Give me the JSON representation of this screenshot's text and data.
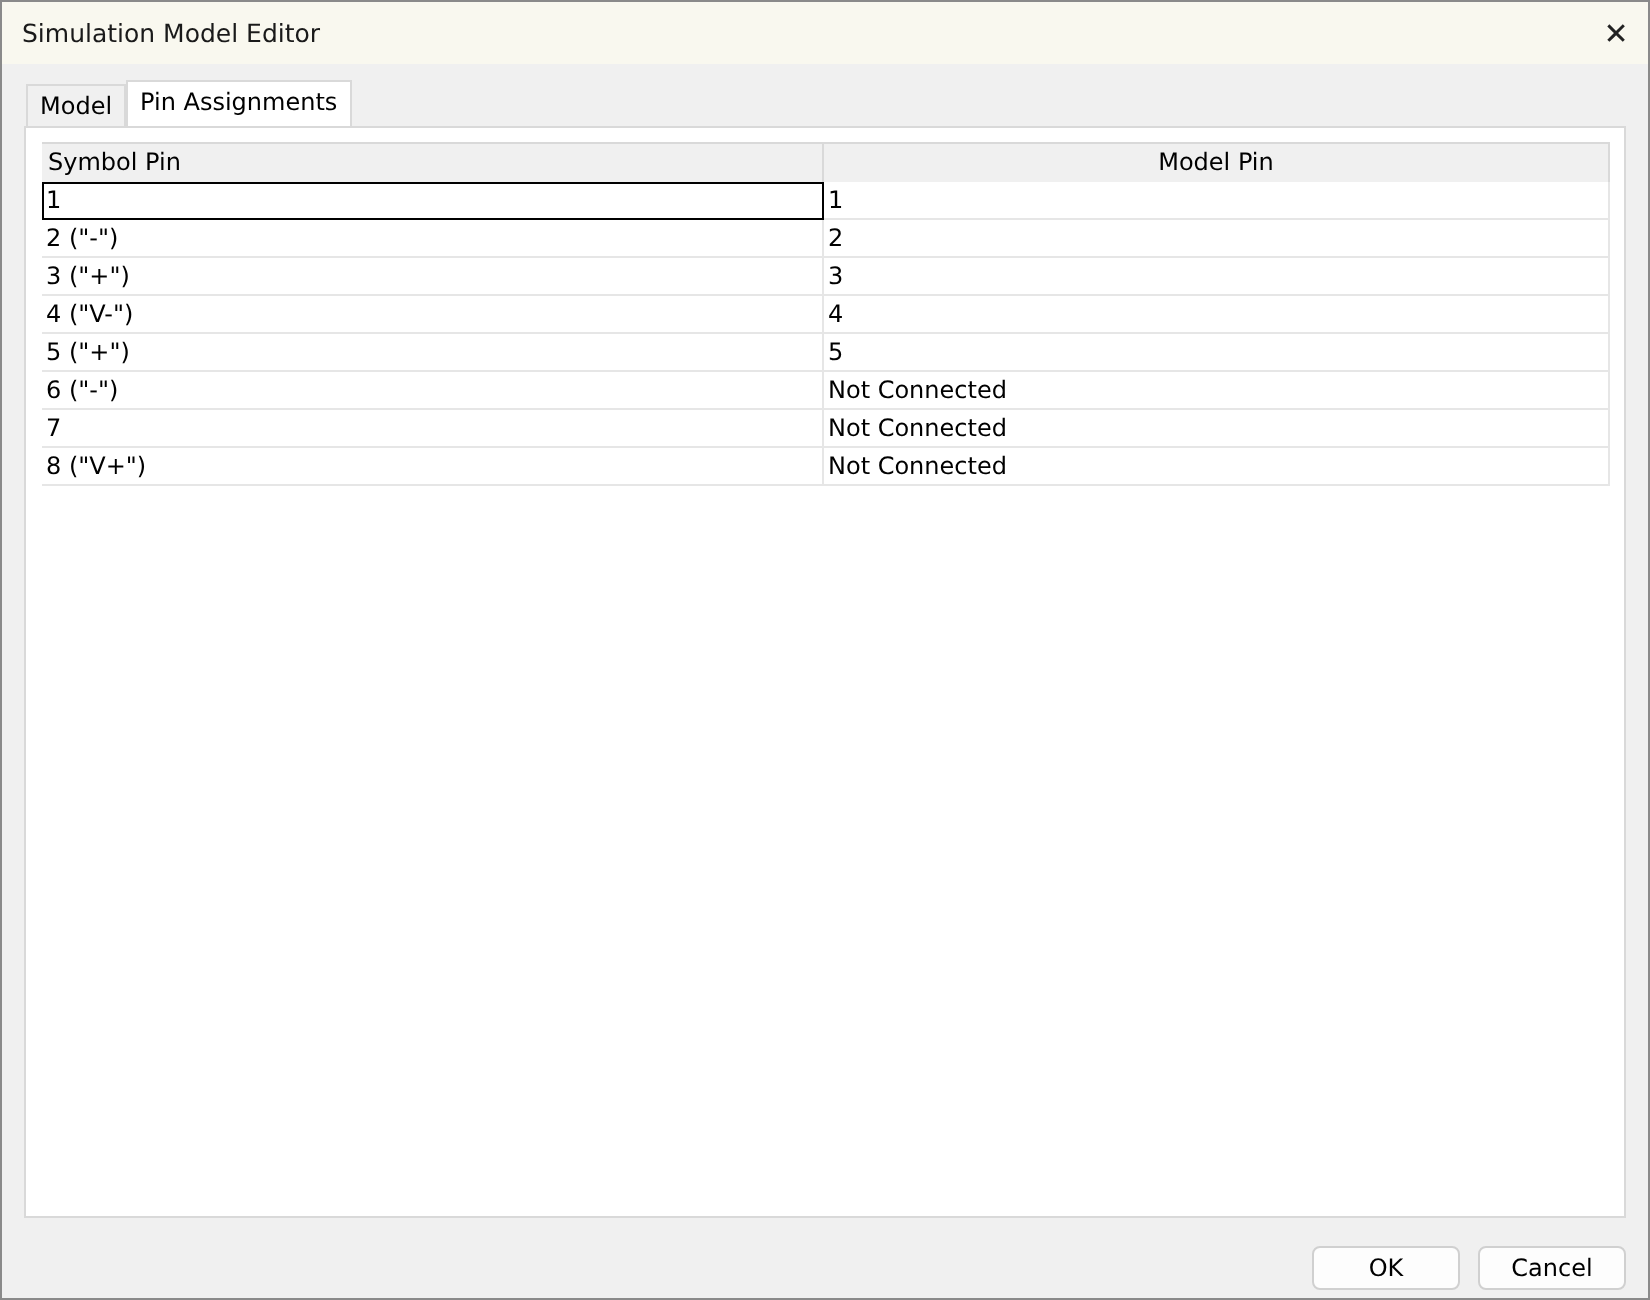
{
  "window": {
    "title": "Simulation Model Editor",
    "close": "✕"
  },
  "tabs": [
    {
      "label": "Model",
      "selected": false
    },
    {
      "label": "Pin Assignments",
      "selected": true
    }
  ],
  "table": {
    "columns": [
      "Symbol Pin",
      "Model Pin"
    ],
    "rows": [
      {
        "cells": [
          "1",
          "1"
        ],
        "focused": true
      },
      {
        "cells": [
          "2 (\"-\")",
          "2"
        ],
        "focused": false
      },
      {
        "cells": [
          "3 (\"+\")",
          "3"
        ],
        "focused": false
      },
      {
        "cells": [
          "4 (\"V-\")",
          "4"
        ],
        "focused": false
      },
      {
        "cells": [
          "5 (\"+\")",
          "5"
        ],
        "focused": false
      },
      {
        "cells": [
          "6 (\"-\")",
          "Not Connected"
        ],
        "focused": false
      },
      {
        "cells": [
          "7",
          "Not Connected"
        ],
        "focused": false
      },
      {
        "cells": [
          "8 (\"V+\")",
          "Not Connected"
        ],
        "focused": false
      }
    ]
  },
  "buttons": [
    "OK",
    "Cancel"
  ]
}
